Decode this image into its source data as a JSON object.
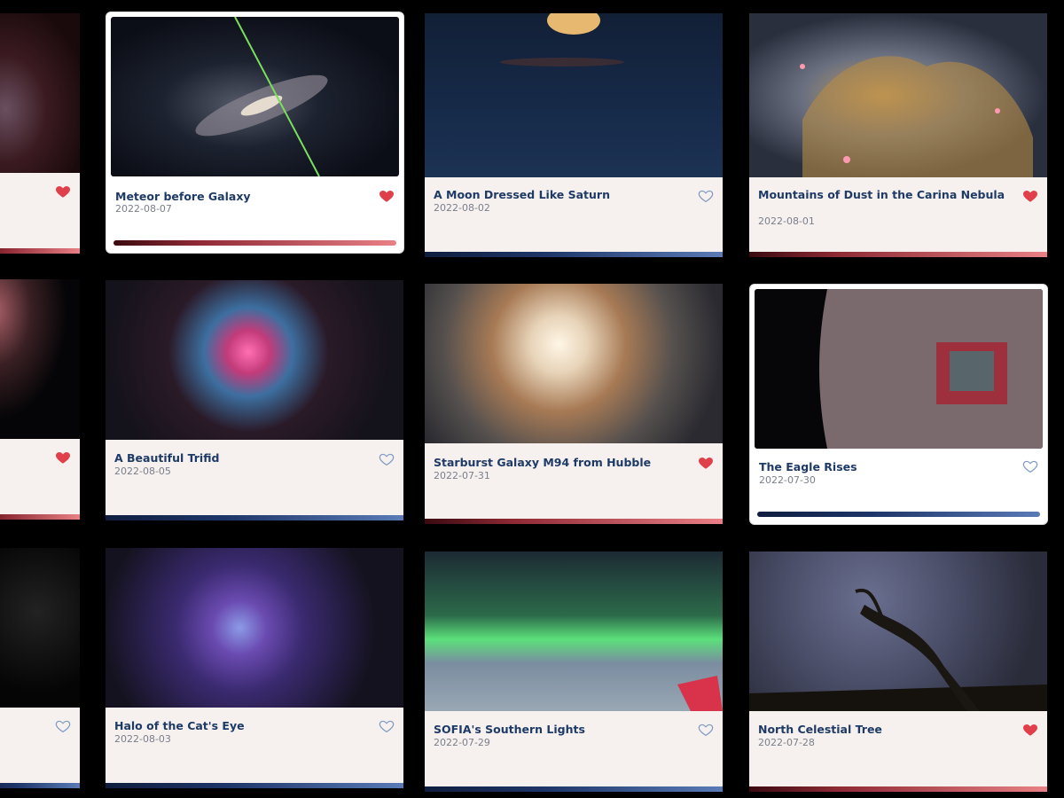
{
  "cards": [
    {
      "title": "",
      "date": "",
      "favorite": true,
      "bar": "red"
    },
    {
      "title": "Meteor before Galaxy",
      "date": "2022-08-07",
      "favorite": true,
      "bar": "red",
      "selected": true
    },
    {
      "title": "A Moon Dressed Like Saturn",
      "date": "2022-08-02",
      "favorite": false,
      "bar": "blue"
    },
    {
      "title": "Mountains of Dust in the Carina Nebula",
      "date": "2022-08-01",
      "favorite": true,
      "bar": "red"
    },
    {
      "title": "",
      "date": "",
      "favorite": true,
      "bar": "red"
    },
    {
      "title": "A Beautiful Trifid",
      "date": "2022-08-05",
      "favorite": false,
      "bar": "blue"
    },
    {
      "title": "Starburst Galaxy M94 from Hubble",
      "date": "2022-07-31",
      "favorite": true,
      "bar": "red"
    },
    {
      "title": "The Eagle Rises",
      "date": "2022-07-30",
      "favorite": false,
      "bar": "blue",
      "selected": true
    },
    {
      "title": "",
      "date": "",
      "favorite": false,
      "bar": "blue"
    },
    {
      "title": "Halo of the Cat's Eye",
      "date": "2022-08-03",
      "favorite": false,
      "bar": "blue"
    },
    {
      "title": "SOFIA's Southern Lights",
      "date": "2022-07-29",
      "favorite": false,
      "bar": "blue"
    },
    {
      "title": "North Celestial Tree",
      "date": "2022-07-28",
      "favorite": true,
      "bar": "red"
    }
  ],
  "colors": {
    "favorite": "#e0404a",
    "unfavorite_stroke": "#7e9ac2",
    "title": "#1e3a66",
    "accent_red": "#e88085",
    "accent_blue": "#1d3568"
  }
}
